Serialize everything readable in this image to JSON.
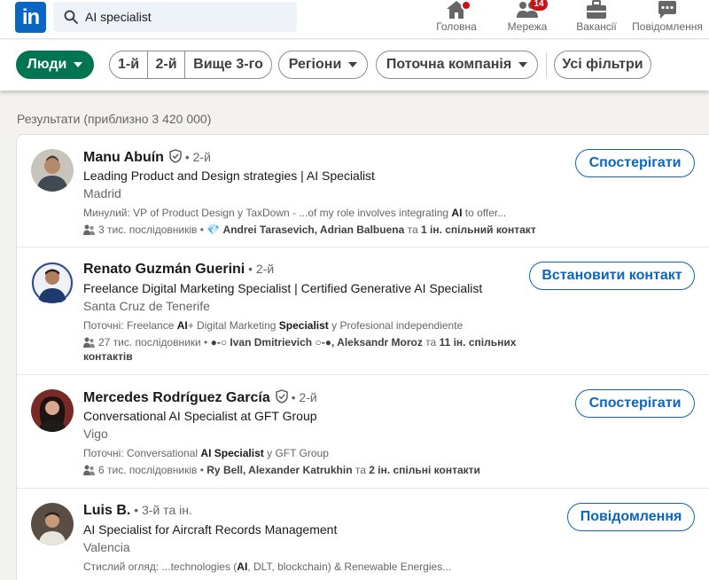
{
  "nav": {
    "logo": "in",
    "search_value": "AI specialist",
    "items": [
      {
        "label": "Головна",
        "icon": "home-icon"
      },
      {
        "label": "Мережа",
        "icon": "network-icon",
        "badge": "14"
      },
      {
        "label": "Вакансії",
        "icon": "briefcase-icon"
      },
      {
        "label": "Повідомлення",
        "icon": "messaging-icon"
      }
    ]
  },
  "filters": {
    "people": "Люди",
    "degrees": [
      "1-й",
      "2-й",
      "Вище 3-го"
    ],
    "regions": "Регіони",
    "current_company": "Поточна компанія",
    "all_filters": "Усі фільтри"
  },
  "results_count": "Результати (приблизно 3 420 000)",
  "results": [
    {
      "name": "Manu Abuín",
      "verified": true,
      "degree": " • 2-й",
      "headline": "Leading Product and Design strategies | AI Specialist",
      "location": "Madrid",
      "snippet_a": "Минулий: VP of Product Design у TaxDown - ...of my role involves integrating ",
      "snippet_b": "AI",
      "snippet_c": " to offer...",
      "followers": "3 тис. послідовників • ",
      "mutual": "Andrei Tarasevich, Adrian Balbuena",
      "mutual_sep": " та ",
      "mutual_count": "1 ін. спільний контакт",
      "action": "Спостерігати"
    },
    {
      "name": "Renato Guzmán Guerini",
      "verified": false,
      "degree": " • 2-й",
      "headline": "Freelance Digital Marketing Specialist | Certified Generative AI Specialist",
      "location": "Santa Cruz de Tenerife",
      "snippet_a": "Поточні: Freelance ",
      "snippet_b": "AI",
      "snippet_c": "+ Digital Marketing ",
      "snippet_d": "Specialist",
      "snippet_e": " у Profesional independiente",
      "followers": "27 тис. послідовники • ",
      "mutual": "●-○ Ivan Dmitrievich ○-●, Aleksandr Moroz",
      "mutual_sep": " та ",
      "mutual_count": "11 ін. спільних контактів",
      "action": "Встановити контакт"
    },
    {
      "name": "Mercedes Rodríguez García",
      "verified": true,
      "degree": " • 2-й",
      "headline": "Conversational AI Specialist at GFT Group",
      "location": "Vigo",
      "snippet_a": "Поточні: Conversational ",
      "snippet_b": "AI Specialist",
      "snippet_c": " у GFT Group",
      "followers": "6 тис. послідовників • ",
      "mutual": "Ry Bell, Alexander Katrukhin",
      "mutual_sep": " та ",
      "mutual_count": "2 ін. спільні контакти",
      "action": "Спостерігати"
    },
    {
      "name": "Luis B.",
      "verified": false,
      "degree": " • 3-й та ін.",
      "headline": "AI Specialist for Aircraft Records Management",
      "location": "Valencia",
      "snippet_a": "Стислий огляд: ...technologies (",
      "snippet_b": "AI",
      "snippet_c": ", DLT, blockchain) & Renewable Energies...",
      "action": "Повідомлення"
    }
  ],
  "colors": {
    "brand": "#0a66c2",
    "active_filter": "#01754f",
    "badge": "#cc1016"
  }
}
